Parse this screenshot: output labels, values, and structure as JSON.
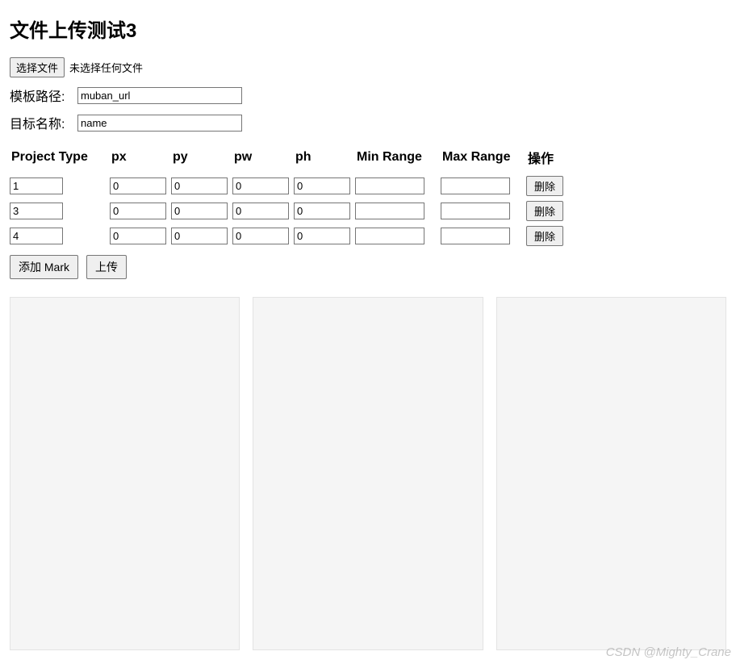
{
  "title": "文件上传测试3",
  "file": {
    "choose_label": "选择文件",
    "status": "未选择任何文件"
  },
  "template_path": {
    "label": "模板路径:",
    "value": "muban_url"
  },
  "target_name": {
    "label": "目标名称:",
    "value": "name"
  },
  "table": {
    "headers": {
      "project_type": "Project Type",
      "px": "px",
      "py": "py",
      "pw": "pw",
      "ph": "ph",
      "min_range": "Min Range",
      "max_range": "Max Range",
      "actions": "操作"
    },
    "rows": [
      {
        "project_type": "1",
        "px": "0",
        "py": "0",
        "pw": "0",
        "ph": "0",
        "min_range": "",
        "max_range": ""
      },
      {
        "project_type": "3",
        "px": "0",
        "py": "0",
        "pw": "0",
        "ph": "0",
        "min_range": "",
        "max_range": ""
      },
      {
        "project_type": "4",
        "px": "0",
        "py": "0",
        "pw": "0",
        "ph": "0",
        "min_range": "",
        "max_range": ""
      }
    ],
    "delete_label": "删除"
  },
  "actions": {
    "add_mark": "添加 Mark",
    "upload": "上传"
  },
  "watermark": "CSDN @Mighty_Crane"
}
